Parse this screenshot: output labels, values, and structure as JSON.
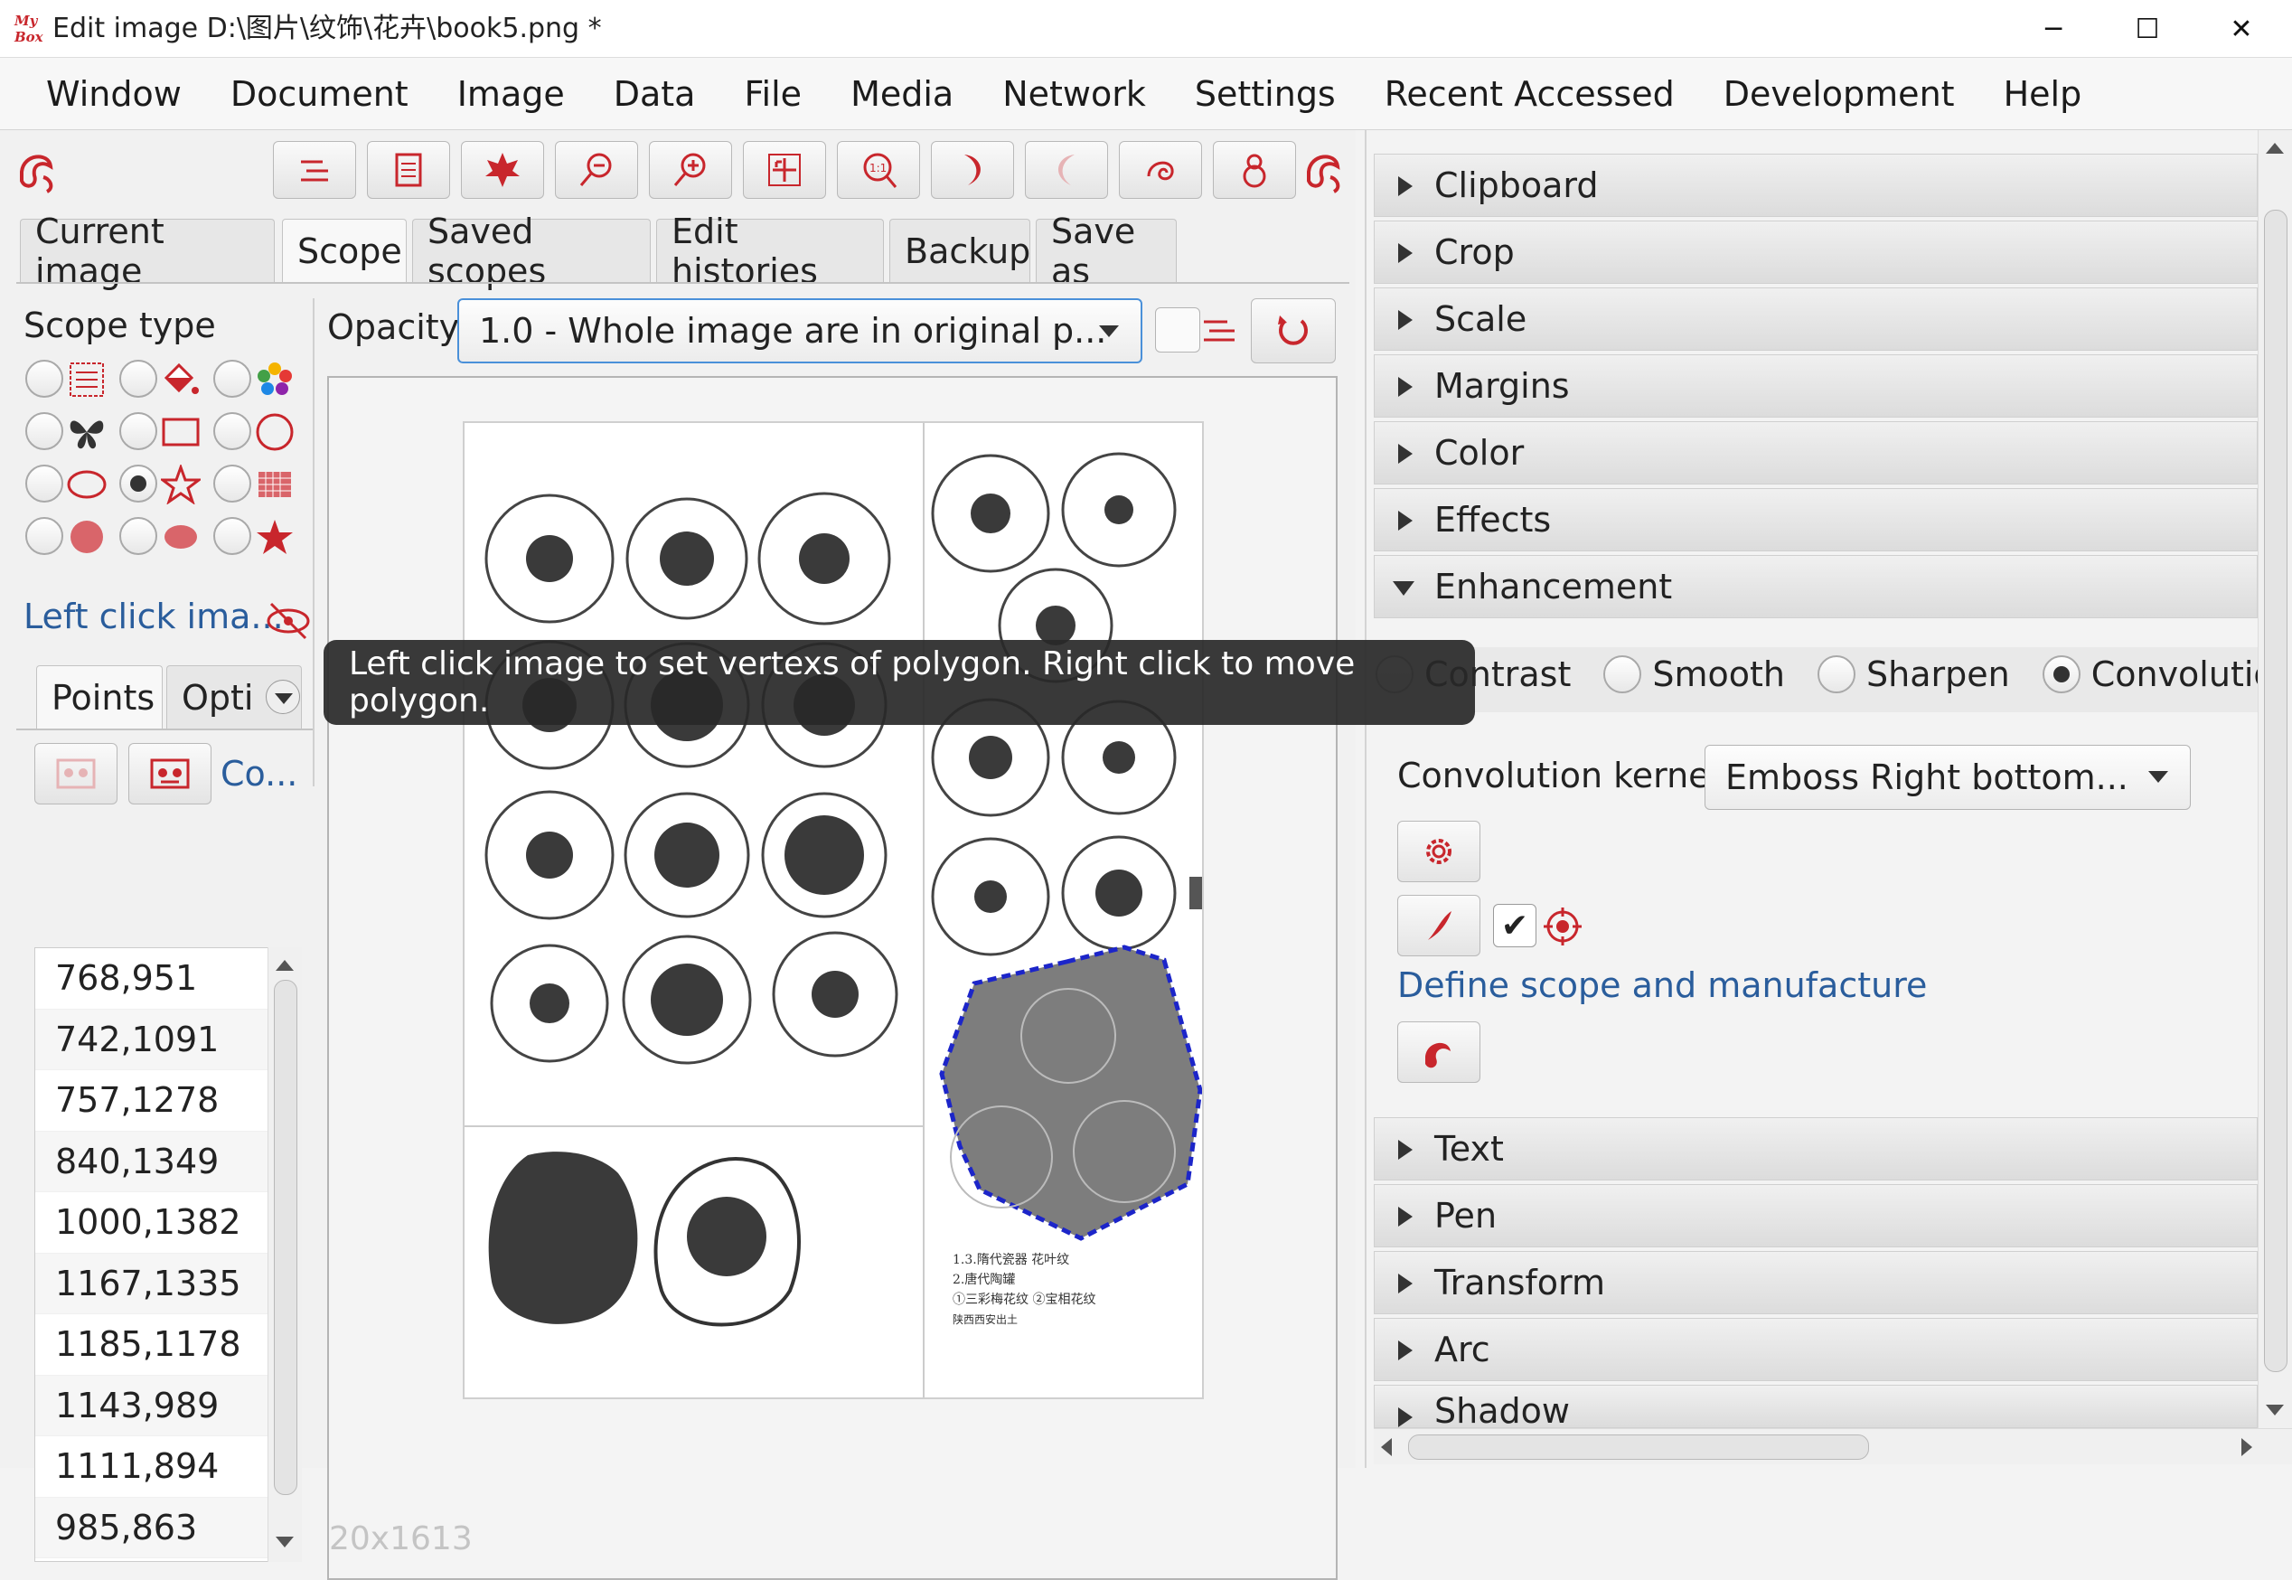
{
  "window": {
    "title": "Edit image D:\\图片\\纹饰\\花卉\\book5.png  *",
    "logo_text": "My Box"
  },
  "menu": [
    "Window",
    "Document",
    "Image",
    "Data",
    "File",
    "Media",
    "Network",
    "Settings",
    "Recent Accessed",
    "Development",
    "Help"
  ],
  "tabs": [
    "Current image",
    "Scope",
    "Saved scopes",
    "Edit histories",
    "Backup",
    "Save as"
  ],
  "scope": {
    "type_label": "Scope type",
    "opacity_label": "Opacity",
    "opacity_value": "1.0 - Whole image are in original p...",
    "hint": "Left click ima...",
    "subtabs": [
      "Points",
      "Opti"
    ],
    "co_link": "Co...",
    "points": [
      "768,951",
      "742,1091",
      "757,1278",
      "840,1349",
      "1000,1382",
      "1167,1335",
      "1185,1178",
      "1143,989",
      "1111,894",
      "985,863"
    ],
    "size_label": "20x1613"
  },
  "tooltip": "Left click image to set vertexs of polygon. Right click to move polygon.",
  "panels_top": [
    "Clipboard",
    "Crop",
    "Scale",
    "Margins",
    "Color",
    "Effects"
  ],
  "enhancement": {
    "title": "Enhancement",
    "options": [
      "Contrast",
      "Smooth",
      "Sharpen",
      "Convolution"
    ],
    "selected": "Convolution",
    "kernel_label": "Convolution kernel",
    "kernel_value": "Emboss Right bottom...",
    "define_link": "Define scope and manufacture"
  },
  "panels_bottom": [
    "Text",
    "Pen",
    "Transform",
    "Arc",
    "Shadow"
  ],
  "colors": {
    "accent": "#c8262c",
    "selection": "#1c25c9",
    "link": "#2a5d9c"
  }
}
